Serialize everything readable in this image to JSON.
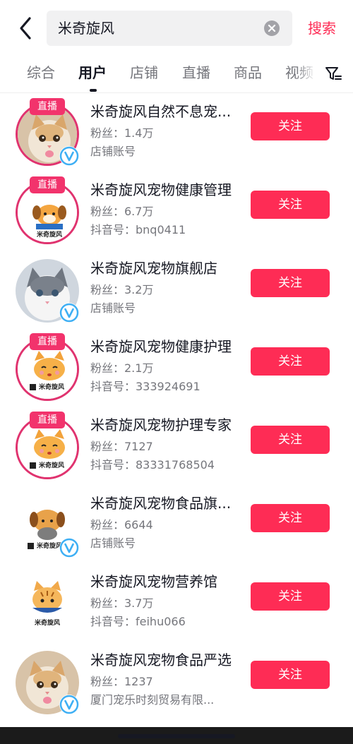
{
  "search": {
    "value": "米奇旋风",
    "button_label": "搜索"
  },
  "tabs": [
    {
      "label": "综合"
    },
    {
      "label": "用户"
    },
    {
      "label": "店铺"
    },
    {
      "label": "直播"
    },
    {
      "label": "商品"
    },
    {
      "label": "视频"
    }
  ],
  "active_tab": "用户",
  "icons": {
    "back": "back-arrow-icon",
    "clear": "clear-icon",
    "filter": "filter-icon",
    "verified": "verified-icon"
  },
  "colors": {
    "accent": "#fe2c55",
    "live_ring": "#e0336f",
    "verified": "#3eaff4"
  },
  "live_badge_label": "直播",
  "follow_label": "关注",
  "users": [
    {
      "name": "米奇旋风自然不息宠...",
      "fans": "粉丝：1.4万",
      "sub": "店铺账号",
      "live": true,
      "verified": true,
      "avatar": "cat-photo"
    },
    {
      "name": "米奇旋风宠物健康管理",
      "fans": "粉丝：6.7万",
      "sub": "抖音号：bnq0411",
      "live": true,
      "verified": false,
      "avatar": "dog-logo",
      "logo_text": "米奇旋风"
    },
    {
      "name": "米奇旋风宠物旗舰店",
      "fans": "粉丝：3.2万",
      "sub": "店铺账号",
      "live": false,
      "verified": true,
      "avatar": "kitten-photo"
    },
    {
      "name": "米奇旋风宠物健康护理",
      "fans": "粉丝：2.1万",
      "sub": "抖音号：333924691",
      "live": true,
      "verified": false,
      "avatar": "cat-logo",
      "logo_text": "米奇旋风"
    },
    {
      "name": "米奇旋风宠物护理专家",
      "fans": "粉丝：7127",
      "sub": "抖音号：83331768504",
      "live": true,
      "verified": false,
      "avatar": "cat-logo",
      "logo_text": "米奇旋风"
    },
    {
      "name": "米奇旋风宠物食品旗...",
      "fans": "粉丝：6644",
      "sub": "店铺账号",
      "live": false,
      "verified": true,
      "avatar": "dog-cat-logo",
      "logo_text": "米奇旋风"
    },
    {
      "name": "米奇旋风宠物营养馆",
      "fans": "粉丝：3.7万",
      "sub": "抖音号：feihu066",
      "live": false,
      "verified": false,
      "avatar": "tiger-cat-logo",
      "logo_text": "米奇旋风"
    },
    {
      "name": "米奇旋风宠物食品严选",
      "fans": "粉丝：1237",
      "sub": "厦门宠乐时刻贸易有限...",
      "live": false,
      "verified": true,
      "avatar": "cat-photo"
    }
  ]
}
